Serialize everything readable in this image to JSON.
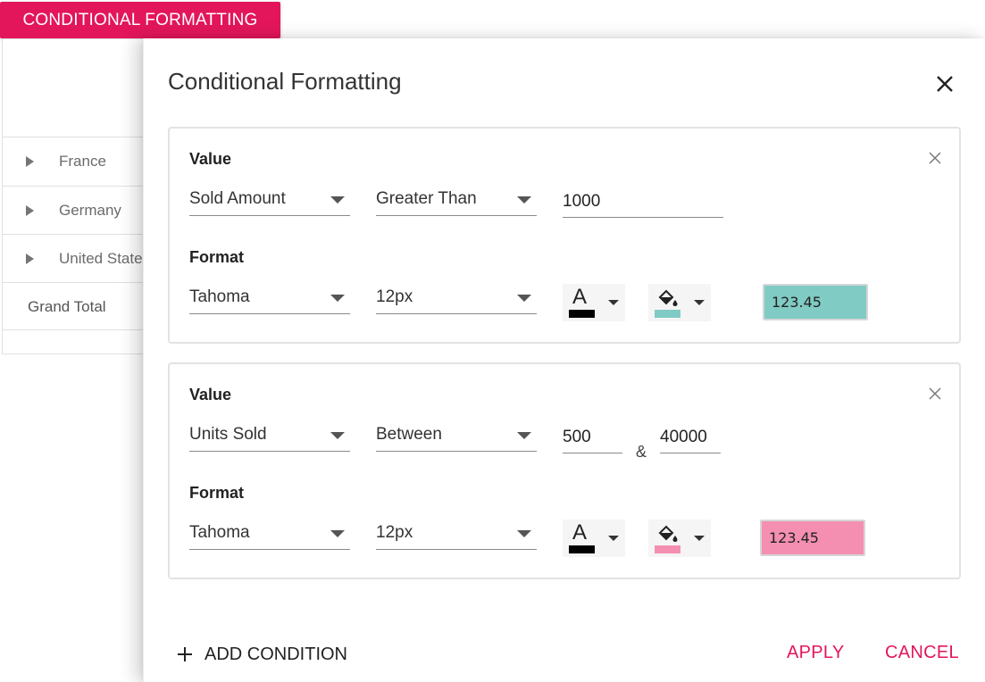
{
  "launcher": {
    "label": "CONDITIONAL FORMATTING"
  },
  "pivot": {
    "rows": [
      {
        "label": "France"
      },
      {
        "label": "Germany"
      },
      {
        "label": "United States"
      }
    ],
    "grand_total": "Grand Total"
  },
  "dialog": {
    "title": "Conditional Formatting",
    "conditions": [
      {
        "value_label": "Value",
        "measure": "Sold Amount",
        "operator": "Greater Than",
        "value1": "1000",
        "format_label": "Format",
        "font_family": "Tahoma",
        "font_size": "12px",
        "font_color": "#000000",
        "background_color": "#80cbc4",
        "preview_text": "123.45"
      },
      {
        "value_label": "Value",
        "measure": "Units Sold",
        "operator": "Between",
        "value1": "500",
        "between_symbol": "&",
        "value2": "40000",
        "format_label": "Format",
        "font_family": "Tahoma",
        "font_size": "12px",
        "font_color": "#000000",
        "background_color": "#f48fb1",
        "preview_text": "123.45"
      }
    ],
    "add_condition_label": "ADD CONDITION",
    "apply_label": "APPLY",
    "cancel_label": "CANCEL"
  },
  "colors": {
    "accent": "#e3165b"
  }
}
